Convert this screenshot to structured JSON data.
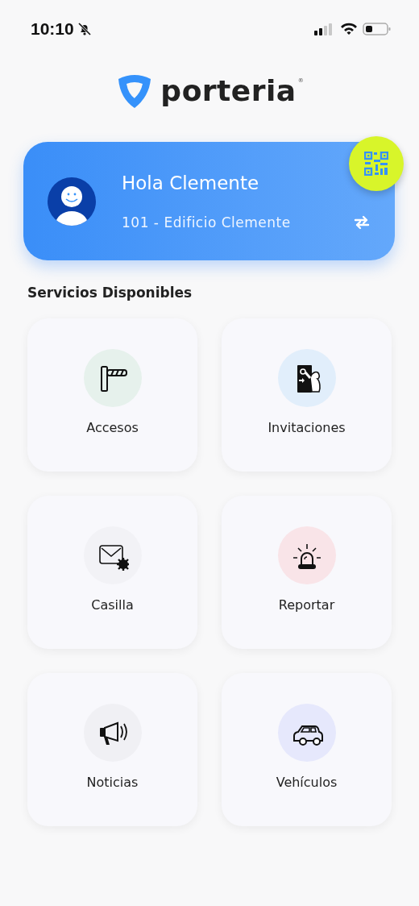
{
  "status_bar": {
    "time": "10:10",
    "silent": true
  },
  "logo": {
    "text": "porteria",
    "mark": "®"
  },
  "profile": {
    "greeting": "Hola Clemente",
    "unit": "101 - Edificio Clemente"
  },
  "section_title": "Servicios Disponibles",
  "services": [
    {
      "label": "Accesos",
      "kind": "barrier",
      "color": "#e6f1ec"
    },
    {
      "label": "Invitaciones",
      "kind": "door",
      "color": "#e1eefb"
    },
    {
      "label": "Casilla",
      "kind": "mail",
      "color": "#f2f2f6"
    },
    {
      "label": "Reportar",
      "kind": "siren",
      "color": "#f9e4e8"
    },
    {
      "label": "Noticias",
      "kind": "megaphone",
      "color": "#f0f0f4"
    },
    {
      "label": "Vehículos",
      "kind": "car",
      "color": "#e6e8fc"
    }
  ]
}
